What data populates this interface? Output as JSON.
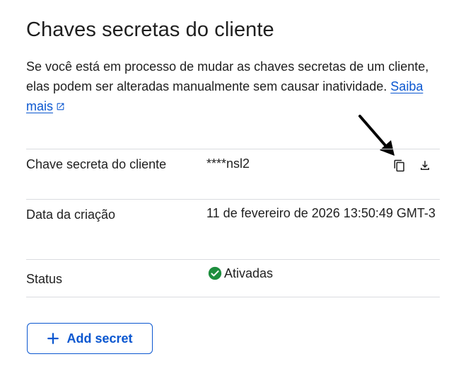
{
  "section": {
    "title": "Chaves secretas do cliente",
    "description": "Se você está em processo de mudar as chaves secretas de um cliente, elas podem ser alteradas manualmente sem causar inatividade.",
    "learn_more": "Saiba mais"
  },
  "table": {
    "rows": [
      {
        "label": "Chave secreta do cliente",
        "value": "****nsl2"
      },
      {
        "label": "Data da criação",
        "value": "11 de fevereiro de 2026 13:50:49 GMT-3"
      },
      {
        "label": "Status",
        "value": "Ativadas"
      }
    ]
  },
  "icons": {
    "copy": "copy-icon",
    "download": "download-icon",
    "status": "check-circle-icon",
    "external": "external-link-icon",
    "add": "plus-icon",
    "annotation": "arrow-annotation"
  },
  "buttons": {
    "add_secret": "Add secret"
  },
  "colors": {
    "link": "#0b57d0",
    "success": "#1e8e3e",
    "text": "#1f1f1f",
    "divider": "#dadce0"
  }
}
